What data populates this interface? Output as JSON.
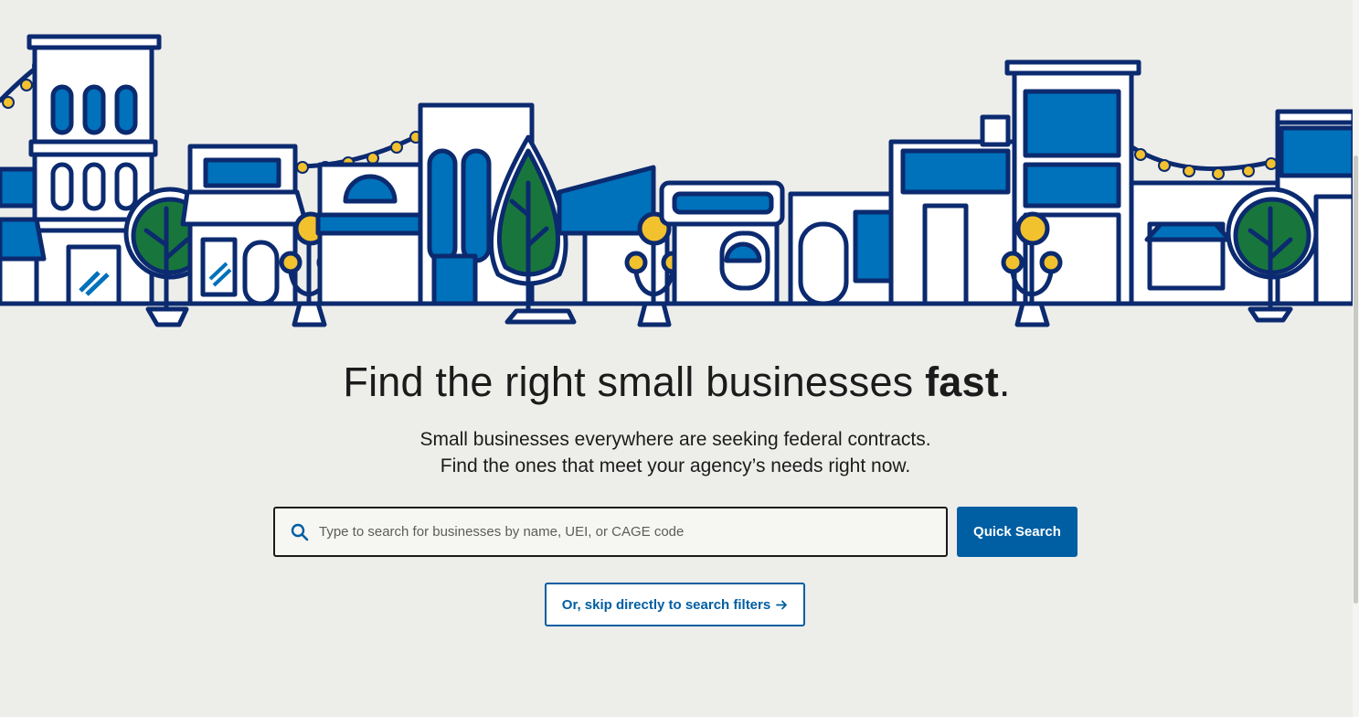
{
  "hero": {
    "headline_prefix": "Find the right small businesses ",
    "headline_bold": "fast",
    "headline_suffix": ".",
    "subtext_line1": "Small businesses everywhere are seeking federal contracts.",
    "subtext_line2": "Find the ones that meet your agency’s needs right now."
  },
  "search": {
    "placeholder": "Type to search for businesses by name, UEI, or CAGE code",
    "value": "",
    "button_label": "Quick Search",
    "icon": "search-icon"
  },
  "skip_link": {
    "label": "Or, skip directly to search filters",
    "icon": "arrow-right-icon"
  },
  "colors": {
    "background": "#ededea",
    "primary": "#005ea2",
    "navy": "#0b2a6f",
    "tree_green": "#18763c",
    "light_yellow": "#f2c12e",
    "text": "#1b1b1b"
  }
}
